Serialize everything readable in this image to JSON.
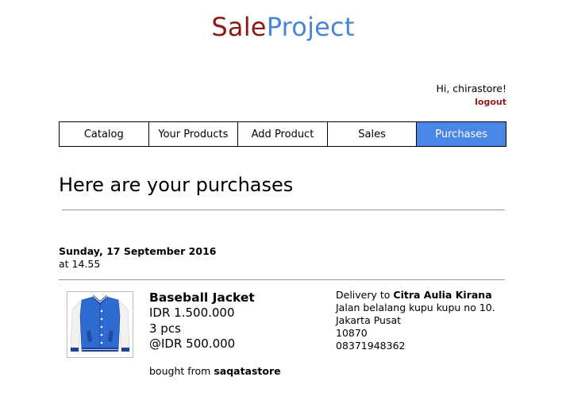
{
  "header": {
    "logo_part1": "Sale",
    "logo_part2": "Project",
    "greeting": "Hi, chirastore!",
    "logout_label": "logout"
  },
  "nav": {
    "tabs": [
      {
        "label": "Catalog",
        "active": false
      },
      {
        "label": "Your Products",
        "active": false
      },
      {
        "label": "Add Product",
        "active": false
      },
      {
        "label": "Sales",
        "active": false
      },
      {
        "label": "Purchases",
        "active": true
      }
    ]
  },
  "main": {
    "title": "Here are your purchases",
    "purchases": [
      {
        "date": "Sunday, 17 September 2016",
        "time": "at 14.55",
        "product": {
          "name": "Baseball Jacket",
          "total_price": "IDR 1.500.000",
          "quantity": "3 pcs",
          "unit_price": "@IDR 500.000",
          "seller_prefix": "bought from",
          "seller": "saqatastore",
          "image_icon": "baseball-jacket-image"
        },
        "delivery": {
          "prefix": "Delivery to",
          "recipient": "Citra Aulia Kirana",
          "address": "Jalan belalang kupu kupu no 10.",
          "city": "Jakarta Pusat",
          "postal_code": "10870",
          "phone": "08371948362"
        }
      }
    ]
  },
  "colors": {
    "brand_dark_red": "#8b1a17",
    "brand_blue": "#4a86d8",
    "active_tab": "#4a86e8",
    "jacket_blue": "#2f6ad0"
  }
}
